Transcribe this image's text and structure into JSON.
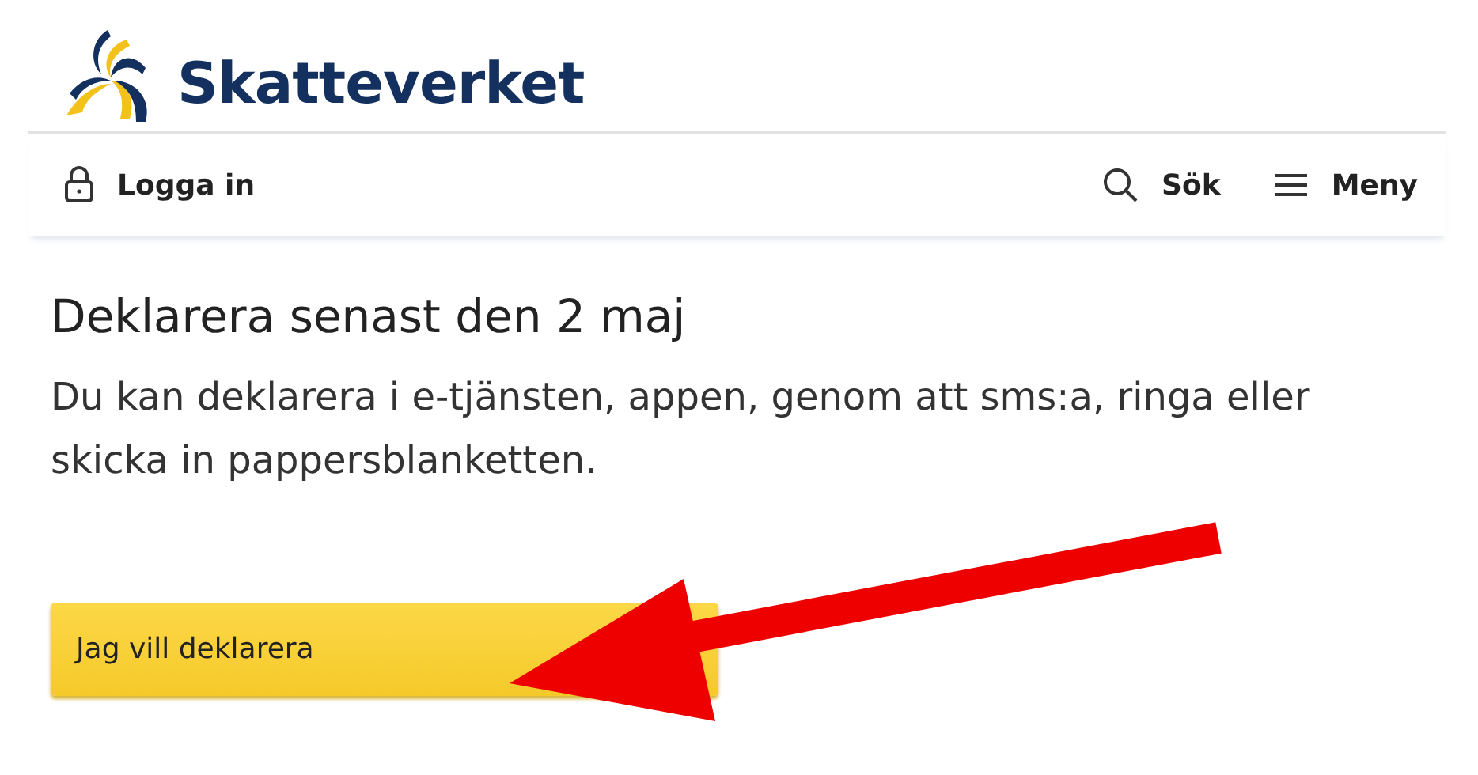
{
  "header": {
    "logo_text": "Skatteverket"
  },
  "nav": {
    "login": "Logga in",
    "search": "Sök",
    "menu": "Meny"
  },
  "content": {
    "heading": "Deklarera senast den 2 maj",
    "text": "Du kan deklarera i e-tjänsten, appen, genom att sms:a, ringa eller skicka in pappersblanketten.",
    "button": "Jag vill deklarera"
  }
}
